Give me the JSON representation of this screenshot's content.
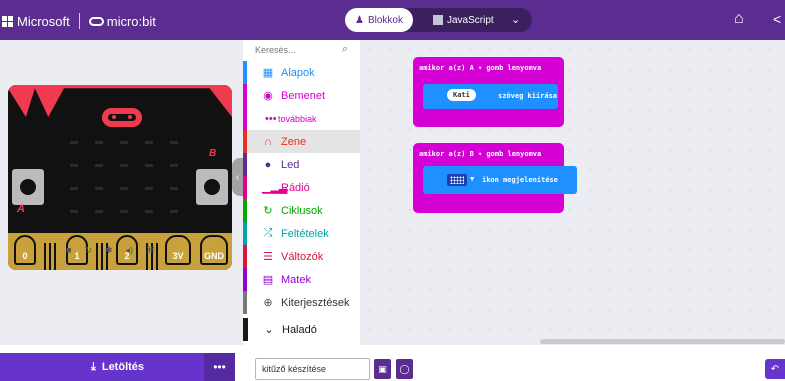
{
  "header": {
    "brand_microsoft": "Microsoft",
    "brand_microbit": "micro:bit",
    "blocks_label": "Blokkok",
    "javascript_label": "JavaScript",
    "colors": {
      "bar": "#5c2d91",
      "blocks_text": "#5c2d91"
    }
  },
  "simulator": {
    "pins": [
      "0",
      "1",
      "2",
      "3V",
      "GND"
    ],
    "button_a": "A",
    "button_b": "B"
  },
  "toolbox": {
    "search_placeholder": "Keresés...",
    "categories": [
      {
        "label": "Alapok",
        "icon": "grid-icon",
        "color": "#1e90ff"
      },
      {
        "label": "Bemenet",
        "icon": "circle-dot-icon",
        "color": "#d400d4"
      },
      {
        "label": "továbbiak",
        "icon": "dots-icon",
        "color": "#d400d4"
      },
      {
        "label": "Zene",
        "icon": "headphones-icon",
        "color": "#e63022"
      },
      {
        "label": "Led",
        "icon": "toggle-icon",
        "color": "#5c2d91"
      },
      {
        "label": "Rádió",
        "icon": "signal-icon",
        "color": "#e3008c"
      },
      {
        "label": "Ciklusok",
        "icon": "refresh-icon",
        "color": "#00aa00"
      },
      {
        "label": "Feltételek",
        "icon": "shuffle-icon",
        "color": "#00a4a6"
      },
      {
        "label": "Változók",
        "icon": "list-icon",
        "color": "#dc143c"
      },
      {
        "label": "Matek",
        "icon": "calculator-icon",
        "color": "#9400d3"
      },
      {
        "label": "Kiterjesztések",
        "icon": "plus-circle-icon",
        "color": "#777777"
      },
      {
        "label": "Haladó",
        "icon": "chevron-down-icon",
        "color": "#1a1a1a"
      }
    ]
  },
  "workspace": {
    "block1": {
      "header": "amikor a(z) A ▾ gomb lenyomva",
      "text_value": "Kati",
      "command": "szöveg kiírása"
    },
    "block2": {
      "header": "amikor a(z) B ▾ gomb lenyomva",
      "command": "ikon megjelenítése"
    }
  },
  "footer": {
    "download_label": "Letöltés",
    "more_label": "•••",
    "project_name": "kitűző készítése"
  }
}
